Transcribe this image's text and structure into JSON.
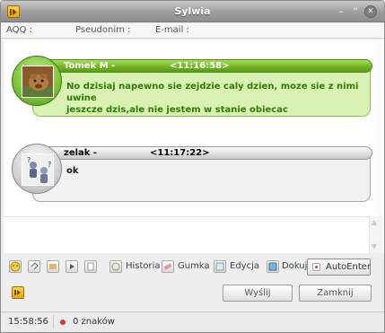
{
  "window": {
    "title": "Sylwia"
  },
  "info_bar": {
    "aqq_label": "AQQ :",
    "nick_label": "Pseudonim :",
    "email_label": "E-mail :"
  },
  "messages": [
    {
      "author": "Tomek M -",
      "time": "<11:16:58>",
      "text_line1": "No dzisiaj napewno sie zejdzie caly dzien, moze sie z nimi uwine",
      "text_line2": "jeszcze dzis,ale nie jestem w stanie obiecac",
      "style": "green"
    },
    {
      "author": "zelak -",
      "time": "<11:17:22>",
      "text_line1": "ok",
      "style": "gray"
    }
  ],
  "toolbar": {
    "history_label": "Historia",
    "eraser_label": "Gumka",
    "edit_label": "Edycja",
    "dock_label": "Dokuj",
    "autoenter_label": "AutoEnter"
  },
  "buttons": {
    "send_label": "Wyślij",
    "close_label": "Zamknij"
  },
  "status": {
    "time": "15:58:56",
    "chars": "0 znaków"
  },
  "colors": {
    "accent_green": "#6fb321",
    "titlebar": "#9d9d9d",
    "logo": "#ffc21f"
  }
}
